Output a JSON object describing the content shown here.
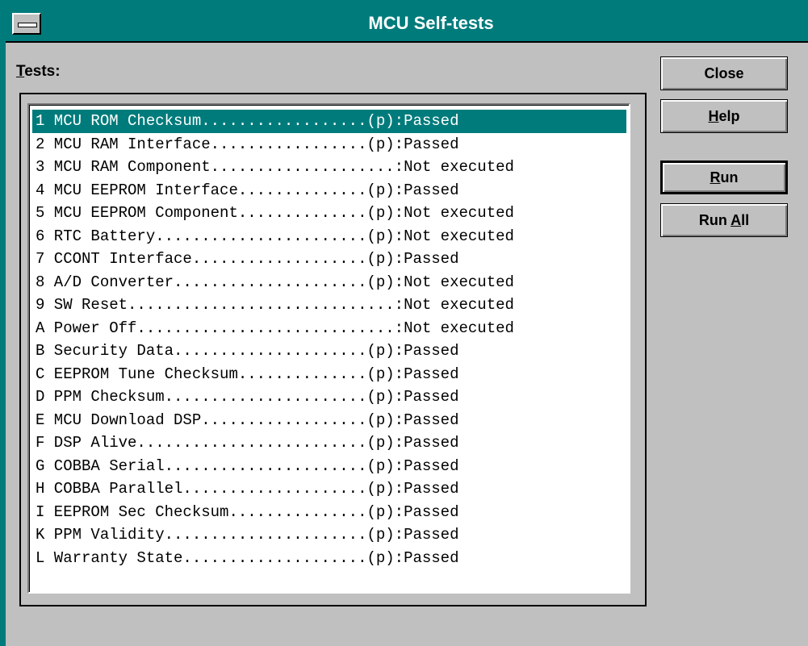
{
  "window": {
    "title": "MCU Self-tests",
    "accent_color": "#007b7b",
    "face_color": "#c0c0c0"
  },
  "tests_label": {
    "mnemonic": "T",
    "rest": "ests:"
  },
  "tests": [
    {
      "text": "1 MCU ROM Checksum..................(p):Passed",
      "selected": true
    },
    {
      "text": "2 MCU RAM Interface.................(p):Passed"
    },
    {
      "text": "3 MCU RAM Component....................:Not executed"
    },
    {
      "text": "4 MCU EEPROM Interface..............(p):Passed"
    },
    {
      "text": "5 MCU EEPROM Component..............(p):Not executed"
    },
    {
      "text": "6 RTC Battery.......................(p):Not executed"
    },
    {
      "text": "7 CCONT Interface...................(p):Passed"
    },
    {
      "text": "8 A/D Converter.....................(p):Not executed"
    },
    {
      "text": "9 SW Reset.............................:Not executed"
    },
    {
      "text": "A Power Off............................:Not executed"
    },
    {
      "text": "B Security Data.....................(p):Passed"
    },
    {
      "text": "C EEPROM Tune Checksum..............(p):Passed"
    },
    {
      "text": "D PPM Checksum......................(p):Passed"
    },
    {
      "text": "E MCU Download DSP..................(p):Passed"
    },
    {
      "text": "F DSP Alive.........................(p):Passed"
    },
    {
      "text": "G COBBA Serial......................(p):Passed"
    },
    {
      "text": "H COBBA Parallel....................(p):Passed"
    },
    {
      "text": "I EEPROM Sec Checksum...............(p):Passed"
    },
    {
      "text": "K PPM Validity......................(p):Passed"
    },
    {
      "text": "L Warranty State....................(p):Passed"
    }
  ],
  "buttons": {
    "close": {
      "label": "Close"
    },
    "help": {
      "pre": "",
      "mnemonic": "H",
      "post": "elp"
    },
    "run": {
      "pre": "",
      "mnemonic": "R",
      "post": "un"
    },
    "run_all": {
      "pre": "Run ",
      "mnemonic": "A",
      "post": "ll"
    }
  }
}
